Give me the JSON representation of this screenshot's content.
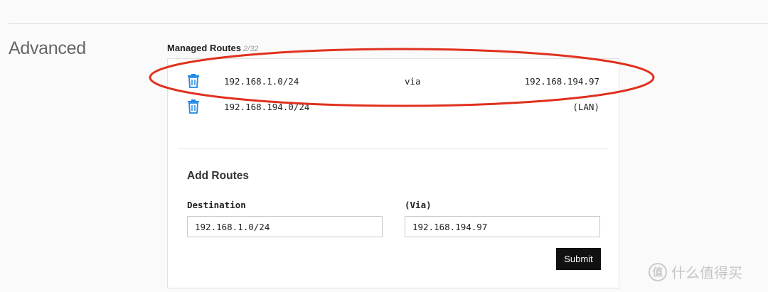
{
  "section": {
    "label": "Advanced"
  },
  "managed_routes": {
    "title": "Managed Routes",
    "count": "2/32",
    "rows": [
      {
        "destination": "192.168.1.0/24",
        "via_label": "via",
        "target": "192.168.194.97",
        "icon": "trash-icon"
      },
      {
        "destination": "192.168.194.0/24",
        "via_label": "",
        "target": "(LAN)",
        "icon": "trash-icon"
      }
    ]
  },
  "add_routes": {
    "title": "Add Routes",
    "destination_label": "Destination",
    "destination_value": "192.168.1.0/24",
    "via_label": "(Via)",
    "via_value": "192.168.194.97",
    "submit_label": "Submit"
  },
  "annotation": {
    "shape": "ellipse",
    "color": "#e0301e"
  },
  "watermark": {
    "badge": "值",
    "text": "什么值得买"
  },
  "colors": {
    "trash": "#1e88e5",
    "button_bg": "#111111",
    "annotation": "#e0301e"
  }
}
